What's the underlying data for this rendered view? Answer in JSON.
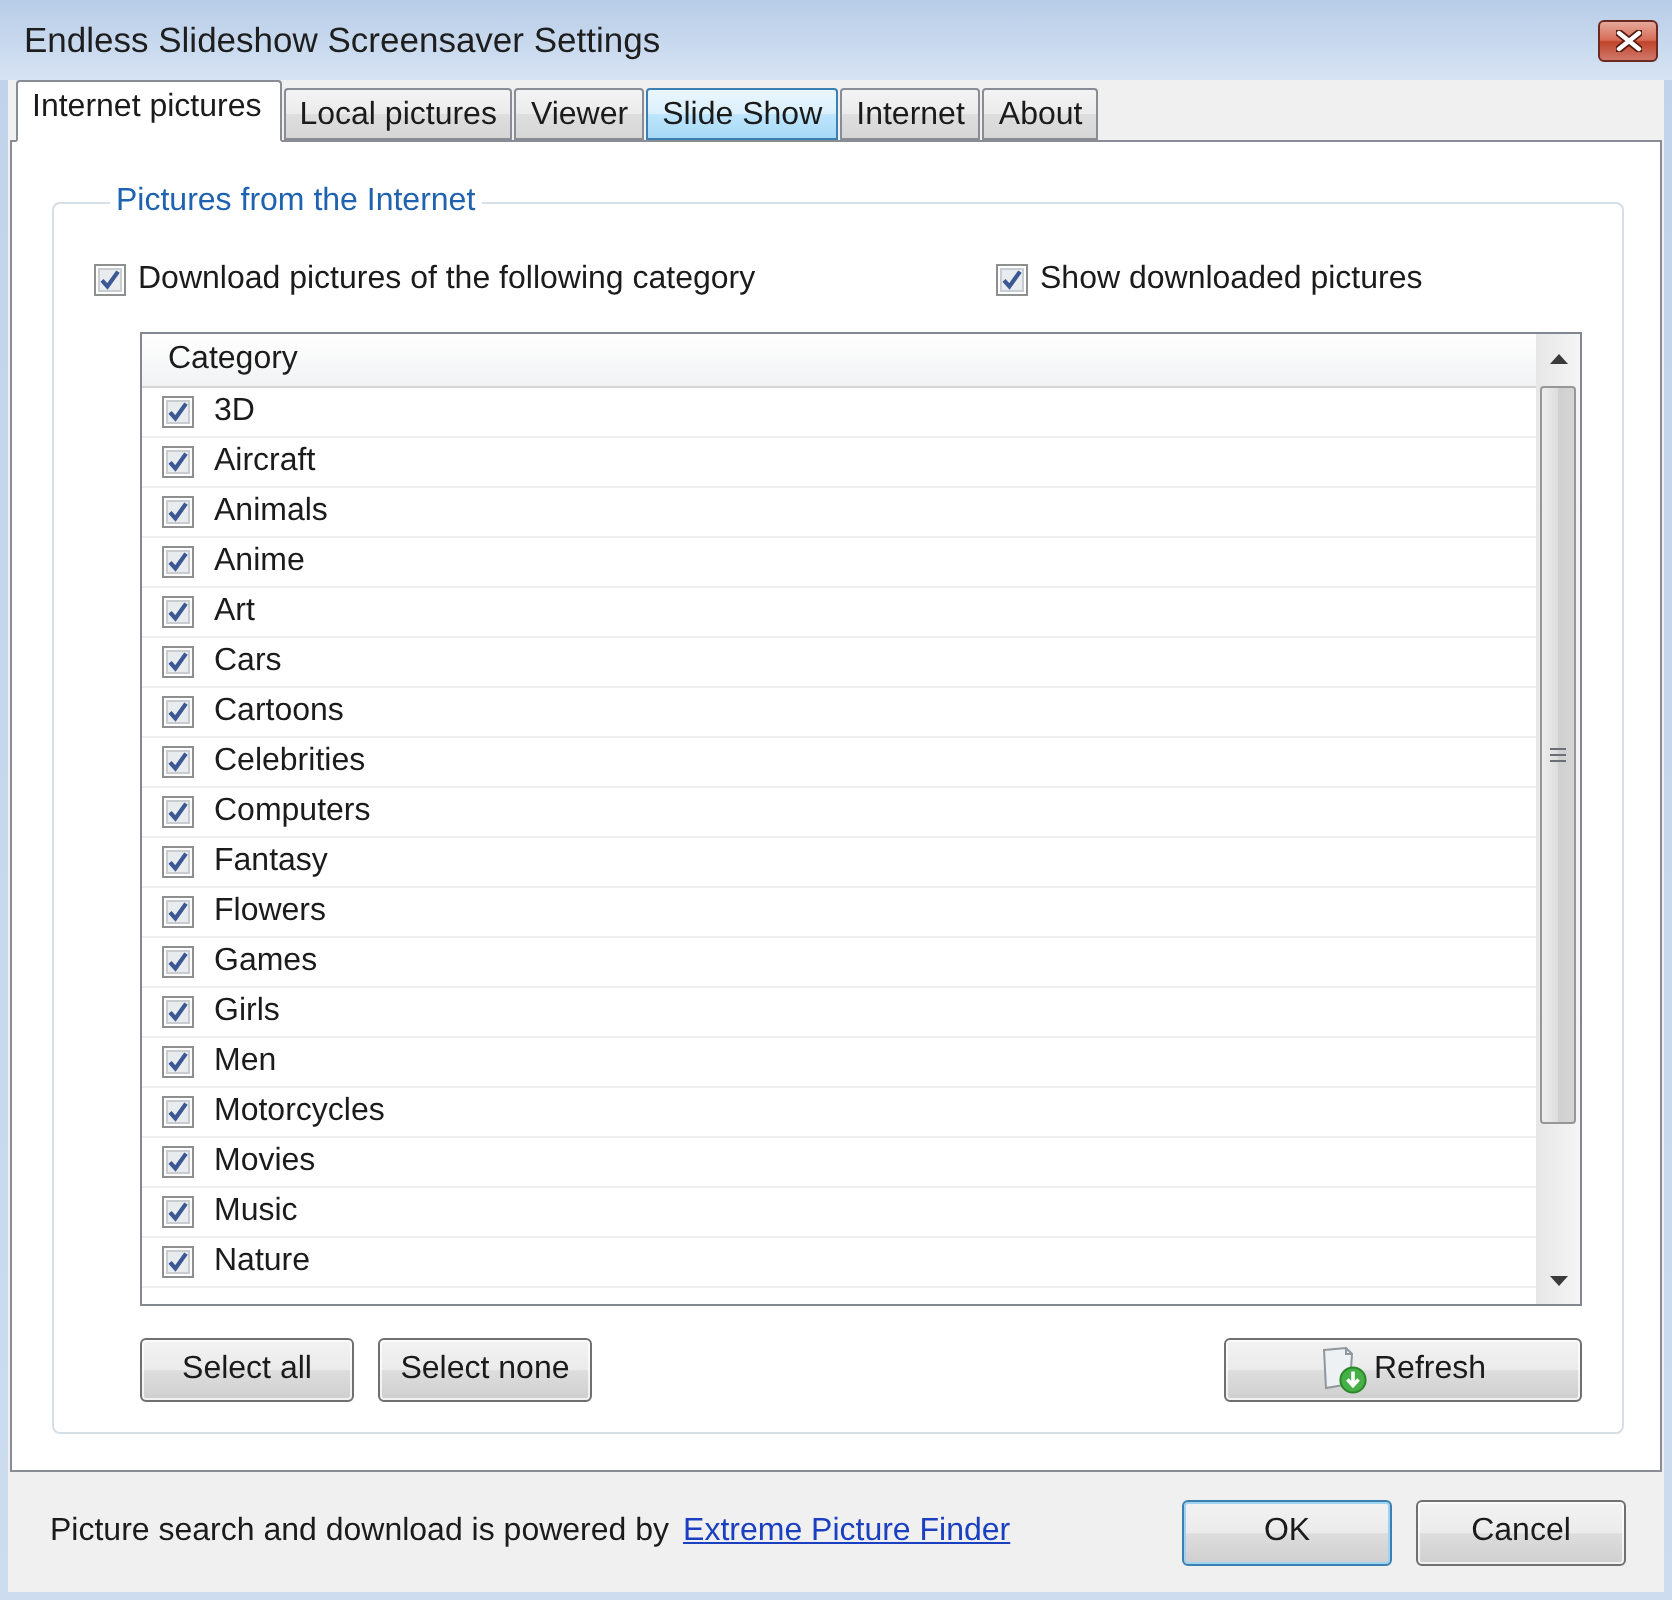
{
  "window": {
    "title": "Endless Slideshow Screensaver Settings"
  },
  "tabs": [
    {
      "label": "Internet pictures",
      "selected": true,
      "hovered": false
    },
    {
      "label": "Local pictures",
      "selected": false,
      "hovered": false
    },
    {
      "label": "Viewer",
      "selected": false,
      "hovered": false
    },
    {
      "label": "Slide Show",
      "selected": false,
      "hovered": true
    },
    {
      "label": "Internet",
      "selected": false,
      "hovered": false
    },
    {
      "label": "About",
      "selected": false,
      "hovered": false
    }
  ],
  "group": {
    "title": "Pictures from the Internet",
    "options": [
      {
        "label": "Download pictures of the following category",
        "checked": true
      },
      {
        "label": "Show downloaded pictures",
        "checked": true
      }
    ],
    "category_list": {
      "column": "Category",
      "rows": [
        {
          "label": "3D",
          "checked": true
        },
        {
          "label": "Aircraft",
          "checked": true
        },
        {
          "label": "Animals",
          "checked": true
        },
        {
          "label": "Anime",
          "checked": true
        },
        {
          "label": "Art",
          "checked": true
        },
        {
          "label": "Cars",
          "checked": true
        },
        {
          "label": "Cartoons",
          "checked": true
        },
        {
          "label": "Celebrities",
          "checked": true
        },
        {
          "label": "Computers",
          "checked": true
        },
        {
          "label": "Fantasy",
          "checked": true
        },
        {
          "label": "Flowers",
          "checked": true
        },
        {
          "label": "Games",
          "checked": true
        },
        {
          "label": "Girls",
          "checked": true
        },
        {
          "label": "Men",
          "checked": true
        },
        {
          "label": "Motorcycles",
          "checked": true
        },
        {
          "label": "Movies",
          "checked": true
        },
        {
          "label": "Music",
          "checked": true
        },
        {
          "label": "Nature",
          "checked": true
        }
      ]
    },
    "list_buttons": [
      "Select all",
      "Select none"
    ],
    "refresh_button": {
      "label": "Refresh"
    }
  },
  "footer": {
    "text": "Picture search and download is powered by",
    "link": "Extreme Picture Finder"
  },
  "dialog_buttons": [
    {
      "label": "OK",
      "default": true
    },
    {
      "label": "Cancel",
      "default": false
    }
  ]
}
